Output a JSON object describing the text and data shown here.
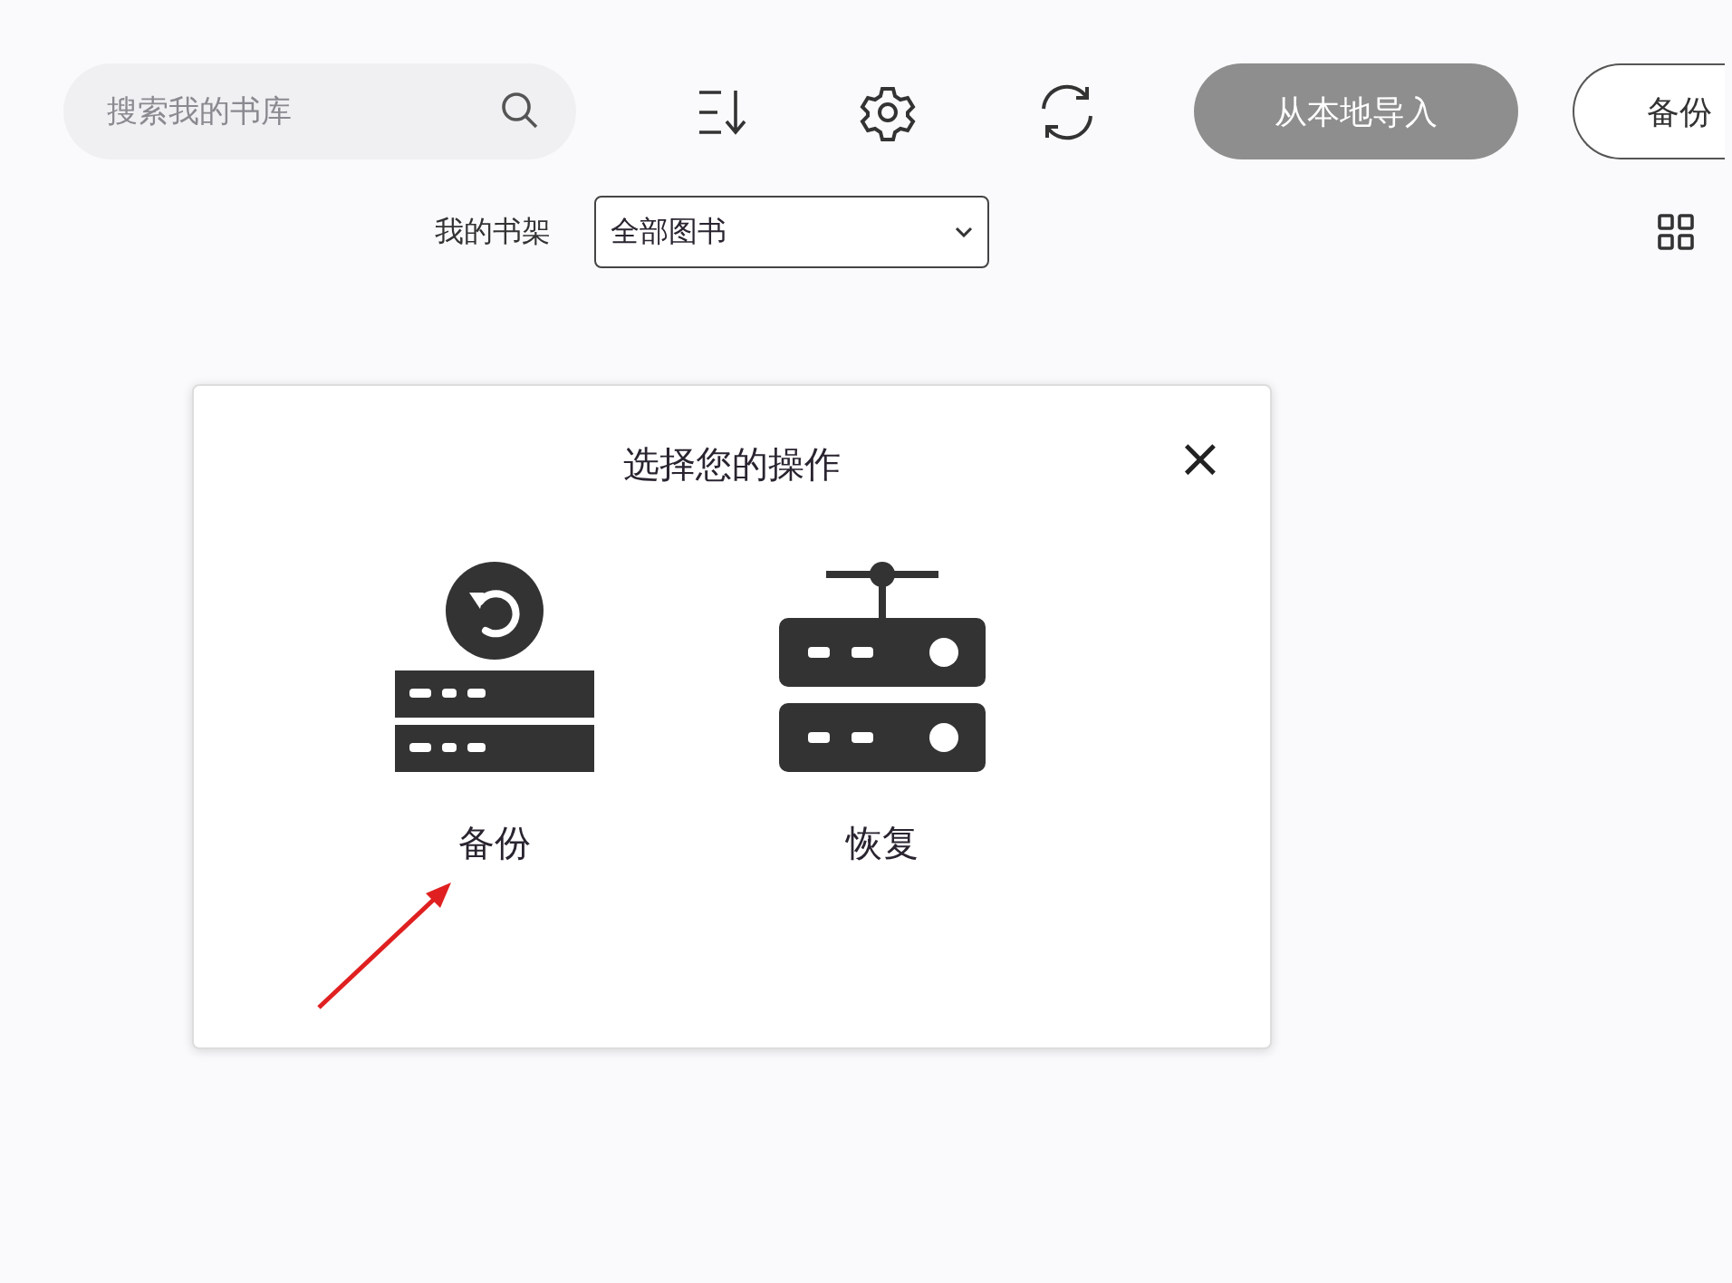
{
  "toolbar": {
    "search": {
      "placeholder": "搜索我的书库"
    },
    "import_button": "从本地导入",
    "backup_button": "备份"
  },
  "filter": {
    "label": "我的书架",
    "select_value": "全部图书"
  },
  "dialog": {
    "title": "选择您的操作",
    "close": "×",
    "options": [
      {
        "kind": "backup",
        "label": "备份"
      },
      {
        "kind": "restore",
        "label": "恢复"
      }
    ]
  }
}
